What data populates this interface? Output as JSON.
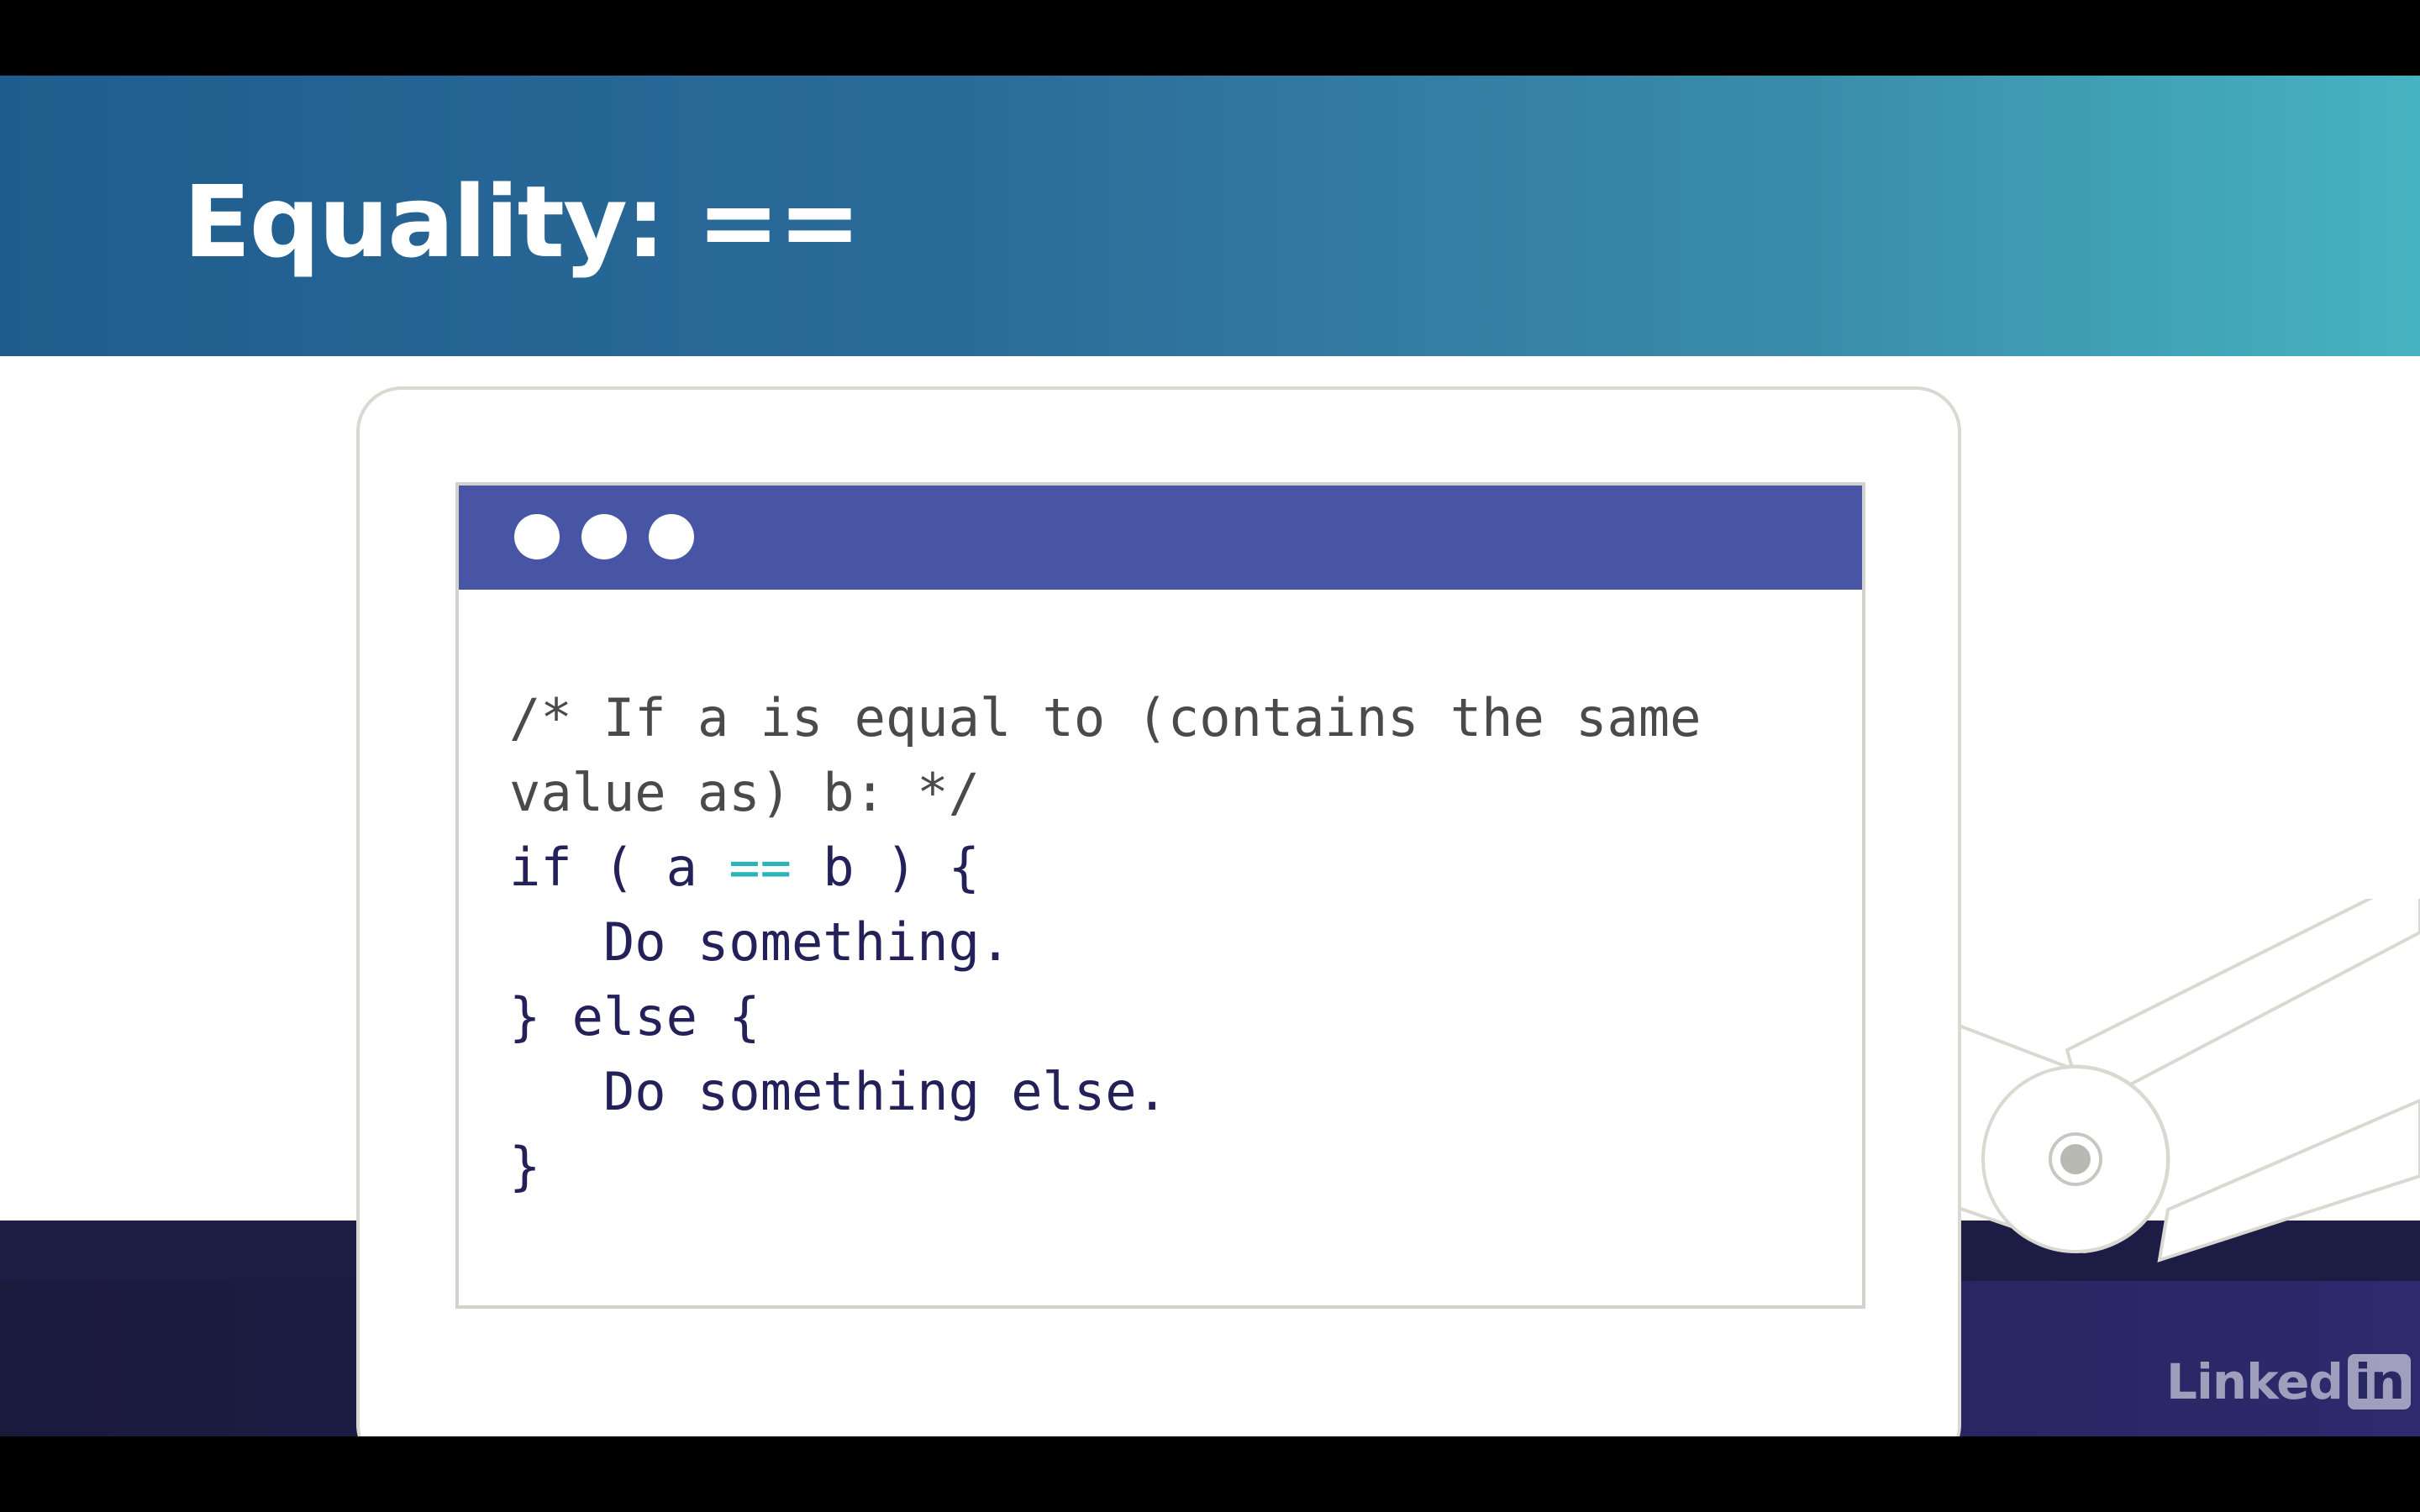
{
  "slide": {
    "title": "Equality: =="
  },
  "code_window": {
    "lines": {
      "l1": "/* If a is equal to (contains the same",
      "l2": "value as) b: */",
      "l3_a": "if ( a ",
      "l3_op": "==",
      "l3_b": " b ) {",
      "l4": "   Do something.",
      "l5": "} else {",
      "l6": "   Do something else.",
      "l7": "}"
    }
  },
  "brand": {
    "text": "Linked",
    "badge": "in"
  },
  "colors": {
    "header_gradient_start": "#1f5d8e",
    "header_gradient_end": "#46b3c1",
    "window_bar": "#4755a4",
    "code_text": "#24215a",
    "operator": "#2ab3b8",
    "footer": "#211f4e"
  }
}
